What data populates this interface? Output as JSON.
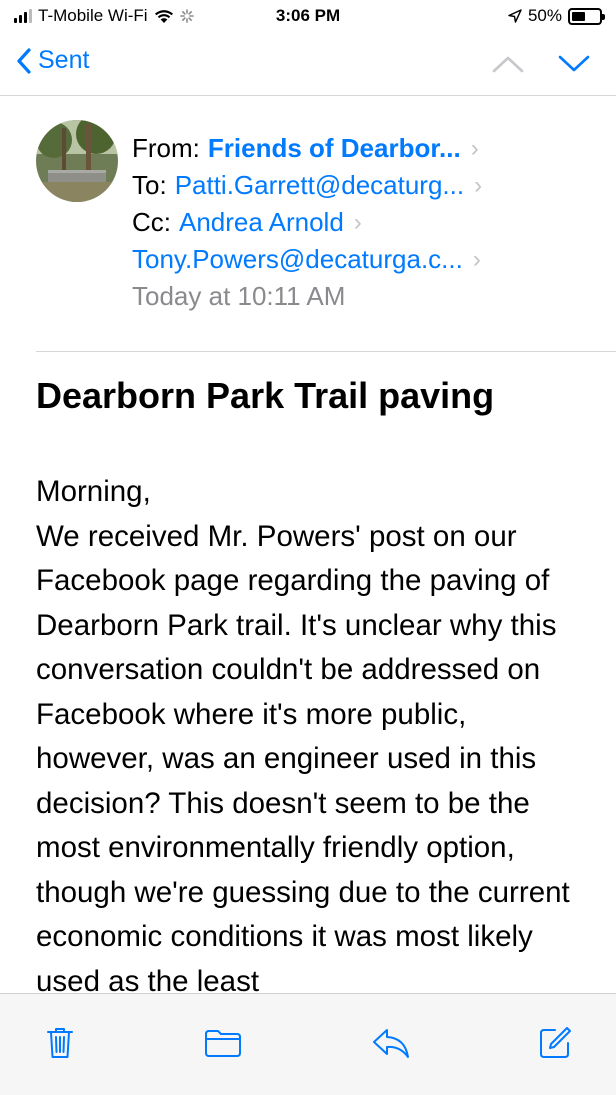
{
  "status_bar": {
    "carrier": "T-Mobile Wi-Fi",
    "time": "3:06 PM",
    "battery": "50%",
    "battery_level": 0.5
  },
  "nav": {
    "back_label": "Sent",
    "icons": [
      "chevron-left-icon",
      "chevron-up-icon",
      "chevron-down-icon"
    ]
  },
  "header": {
    "from_label": "From:",
    "from_name": "Friends of Dearbor...",
    "to_label": "To:",
    "to_address": "Patti.Garrett@decaturg...",
    "cc_label": "Cc:",
    "cc_name": "Andrea Arnold",
    "cc_address2": "Tony.Powers@decaturga.c...",
    "date": "Today at 10:11 AM"
  },
  "message": {
    "subject": "Dearborn Park Trail paving",
    "greeting": "Morning,",
    "body": "We received Mr. Powers' post on our Facebook page regarding the paving of Dearborn Park trail. It's unclear why this conversation couldn't be addressed on Facebook where it's more public, however, was an engineer used in this decision? This doesn't seem to be the most environmentally friendly option, though we're guessing due to the current economic conditions it was most likely used as the least"
  },
  "toolbar": {
    "icons": [
      "trash-icon",
      "folder-icon",
      "reply-icon",
      "compose-icon"
    ]
  },
  "colors": {
    "accent": "#007aff",
    "secondary_text": "#8a8a8e",
    "chevron": "#c4c4c9",
    "toolbar_bg": "#f6f6f6"
  }
}
